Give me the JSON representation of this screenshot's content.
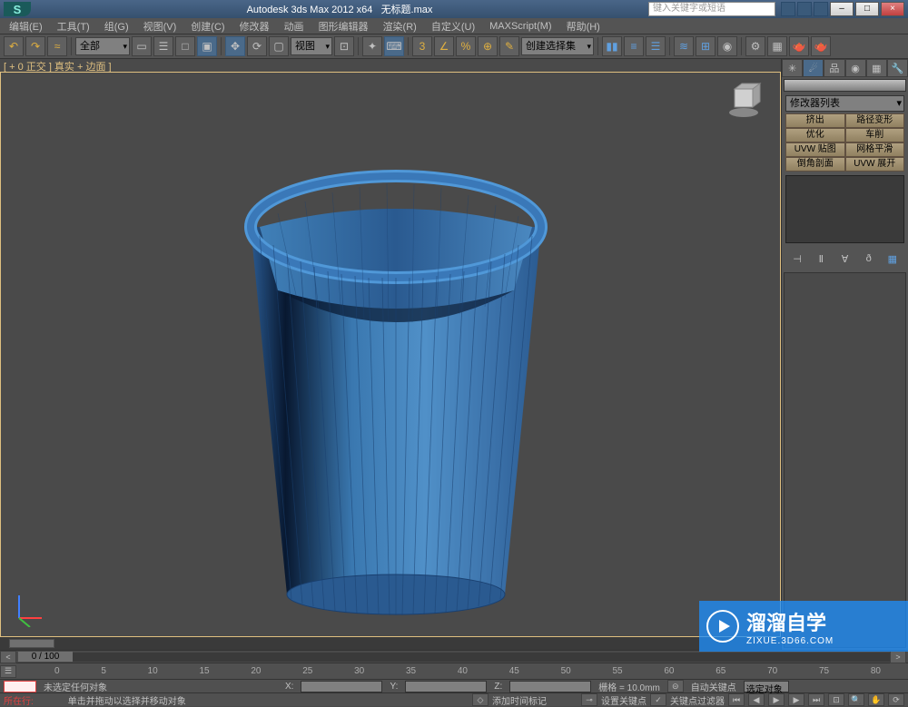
{
  "title": {
    "app": "Autodesk 3ds Max 2012 x64",
    "file": "无标题.max",
    "search_placeholder": "键入关键字或短语"
  },
  "menu": {
    "edit": "编辑(E)",
    "tools": "工具(T)",
    "group": "组(G)",
    "views": "视图(V)",
    "create": "创建(C)",
    "modifiers": "修改器",
    "animation": "动画",
    "graph": "图形编辑器",
    "rendering": "渲染(R)",
    "customize": "自定义(U)",
    "maxscript": "MAXScript(M)",
    "help": "帮助(H)"
  },
  "toolbar": {
    "all": "全部",
    "view": "视图",
    "selection_set": "创建选择集"
  },
  "viewport": {
    "label": "[ + 0 正交 ] 真实 + 边面 ]"
  },
  "rightpanel": {
    "dropdown": "修改器列表",
    "buttons": {
      "extrude": "挤出",
      "bevel": "路径变形",
      "optimize": "优化",
      "lathe": "车削",
      "uvw_map": "UVW 贴图",
      "mesh_smooth": "网格平滑",
      "chamfer": "倒角剖面",
      "uvw_unwrap": "UVW 展开"
    }
  },
  "timeline": {
    "slider_label": "0 / 100",
    "ticks": [
      "0",
      "5",
      "10",
      "15",
      "20",
      "25",
      "30",
      "35",
      "40",
      "45",
      "50",
      "55",
      "60",
      "65",
      "70",
      "75",
      "80"
    ]
  },
  "status": {
    "no_selection": "未选定任何对象",
    "x_label": "X:",
    "y_label": "Y:",
    "z_label": "Z:",
    "grid": "栅格 = 10.0mm",
    "hint": "单击并拖动以选择并移动对象",
    "add_time_tag": "添加时间标记",
    "location": "所在行:",
    "auto_key": "自动关键点",
    "set_key": "设置关键点",
    "sel_obj": "选定对象",
    "key_filter": "关键点过滤器"
  },
  "watermark": {
    "big": "溜溜自学",
    "small": "ZIXUE.3D66.COM"
  }
}
